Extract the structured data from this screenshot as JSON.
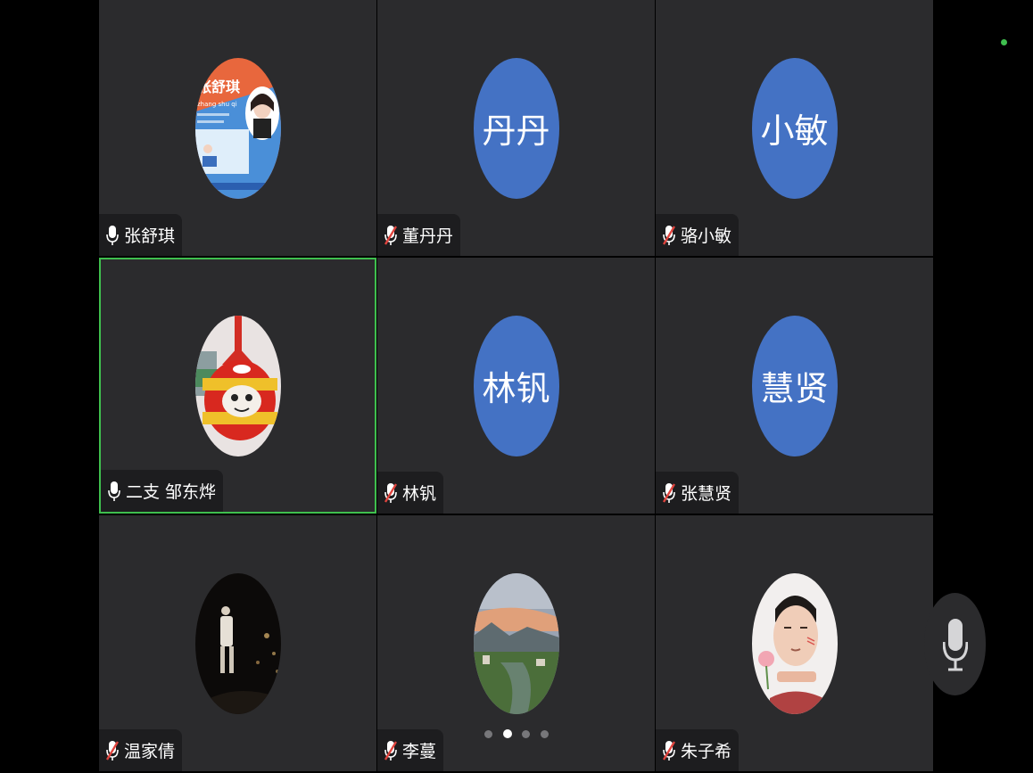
{
  "participants": [
    {
      "name": "张舒琪",
      "mic": "on",
      "avatar_type": "photo-poster",
      "active": false
    },
    {
      "name": "董丹丹",
      "mic": "muted",
      "avatar_type": "text",
      "avatar_text": "丹丹",
      "active": false
    },
    {
      "name": "骆小敏",
      "mic": "muted",
      "avatar_type": "text",
      "avatar_text": "小敏",
      "active": false
    },
    {
      "name": "二支 邹东烨",
      "mic": "on",
      "avatar_type": "photo-cartoon",
      "active": true
    },
    {
      "name": "林钒",
      "mic": "muted",
      "avatar_type": "text",
      "avatar_text": "林钒",
      "active": false
    },
    {
      "name": "张慧贤",
      "mic": "muted",
      "avatar_type": "text",
      "avatar_text": "慧贤",
      "active": false
    },
    {
      "name": "温家倩",
      "mic": "muted",
      "avatar_type": "photo-night",
      "active": false
    },
    {
      "name": "李蔓",
      "mic": "muted",
      "avatar_type": "photo-landscape",
      "active": false
    },
    {
      "name": "朱子希",
      "mic": "muted",
      "avatar_type": "photo-person",
      "active": false
    }
  ],
  "poster": {
    "title": "张舒琪",
    "subtitle": "zhang shu qi"
  },
  "pagination": {
    "pages": 4,
    "current": 2
  },
  "colors": {
    "tile_bg": "#2b2b2d",
    "avatar_blue": "#4472c4",
    "active_border": "#3fbf4e",
    "muted_red": "#e0443e",
    "background": "#000000"
  },
  "icons": {
    "mic_on": "microphone-icon",
    "mic_muted": "microphone-muted-icon",
    "floating": "microphone-icon"
  }
}
